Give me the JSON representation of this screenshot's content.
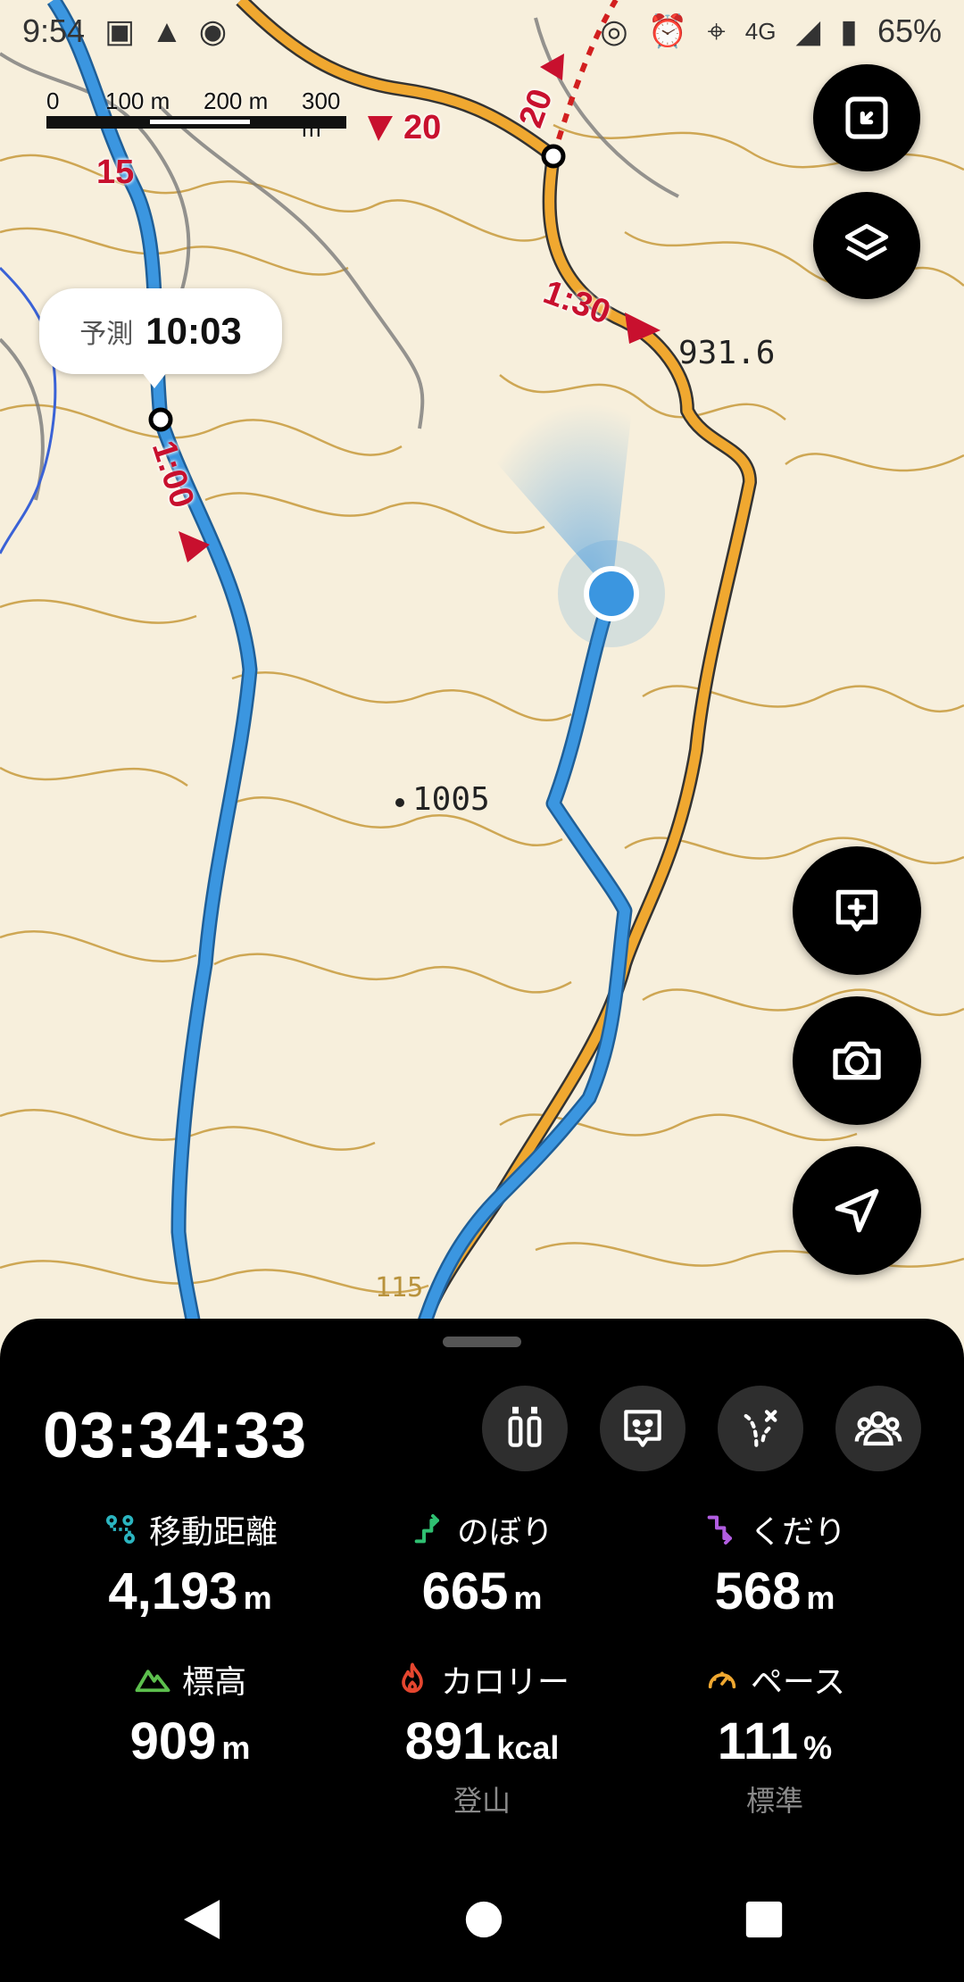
{
  "status_bar": {
    "time": "9:54",
    "battery": "65%",
    "network": "4G",
    "icons": [
      "box-icon",
      "warning-icon",
      "wifi-icon",
      "nfc-icon",
      "alarm-icon",
      "location-icon",
      "signal-icon",
      "battery-icon"
    ]
  },
  "map": {
    "scale_labels": [
      "0",
      "100 m",
      "200 m",
      "300 m"
    ],
    "spot_heights": [
      "931.6",
      "1005"
    ],
    "contour_label": "115",
    "route_labels": [
      "15",
      "20",
      "20",
      "1:30",
      "1:00"
    ],
    "colors": {
      "own_track": "#3b96e0",
      "planned_route": "#f0a830",
      "contour": "#c79a3c",
      "route_time": "#c8102e"
    }
  },
  "eta": {
    "label": "予測",
    "time": "10:03"
  },
  "map_buttons": [
    {
      "icon": "fit-screen-icon"
    },
    {
      "icon": "layers-icon"
    },
    {
      "icon": "add-memo-icon"
    },
    {
      "icon": "camera-icon"
    },
    {
      "icon": "navigation-icon"
    }
  ],
  "sheet": {
    "elapsed": "03:34:33",
    "tools": [
      "water-bottles-icon",
      "face-memo-icon",
      "route-edit-icon",
      "group-icon"
    ],
    "stats": [
      {
        "label": "移動距離",
        "value": "4,193",
        "unit": "m",
        "sub": "",
        "icon": "distance-icon",
        "color": "#2bb5c0"
      },
      {
        "label": "のぼり",
        "value": "665",
        "unit": "m",
        "sub": "",
        "icon": "ascent-icon",
        "color": "#2fbf71"
      },
      {
        "label": "くだり",
        "value": "568",
        "unit": "m",
        "sub": "",
        "icon": "descent-icon",
        "color": "#b15de0"
      },
      {
        "label": "標高",
        "value": "909",
        "unit": "m",
        "sub": "",
        "icon": "mountain-icon",
        "color": "#5cbf4d"
      },
      {
        "label": "カロリー",
        "value": "891",
        "unit": "kcal",
        "sub": "登山",
        "icon": "flame-icon",
        "color": "#e5462f"
      },
      {
        "label": "ペース",
        "value": "111",
        "unit": "%",
        "sub": "標準",
        "icon": "speedometer-icon",
        "color": "#f0a830"
      }
    ]
  }
}
